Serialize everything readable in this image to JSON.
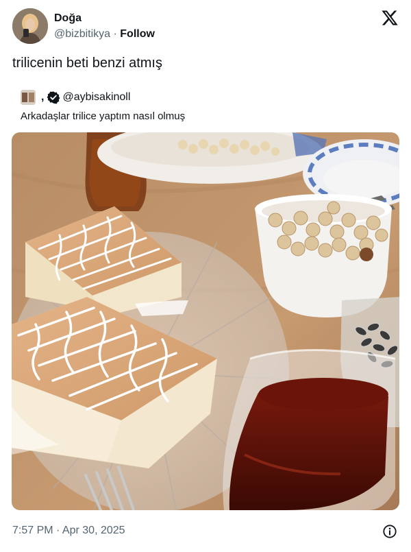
{
  "author": {
    "name": "Doğa",
    "handle": "@bizbitikya",
    "separator": " · ",
    "follow_label": "Follow"
  },
  "tweet": {
    "text": "trilicenin beti benzi atmış",
    "timestamp": "7:57 PM · Apr 30, 2025"
  },
  "quoted": {
    "name": ",",
    "handle": "@aybisakinoll",
    "text": "Arkadaşlar trilice yaptım nasıl olmuş",
    "verified": true
  },
  "icons": {
    "brand": "x-logo-icon",
    "verified": "verified-badge-icon",
    "info": "info-icon"
  },
  "colors": {
    "text": "#0f1419",
    "muted": "#536471",
    "cake": "#d9a87a",
    "tea": "#5a1208",
    "table": "#c2946a"
  }
}
